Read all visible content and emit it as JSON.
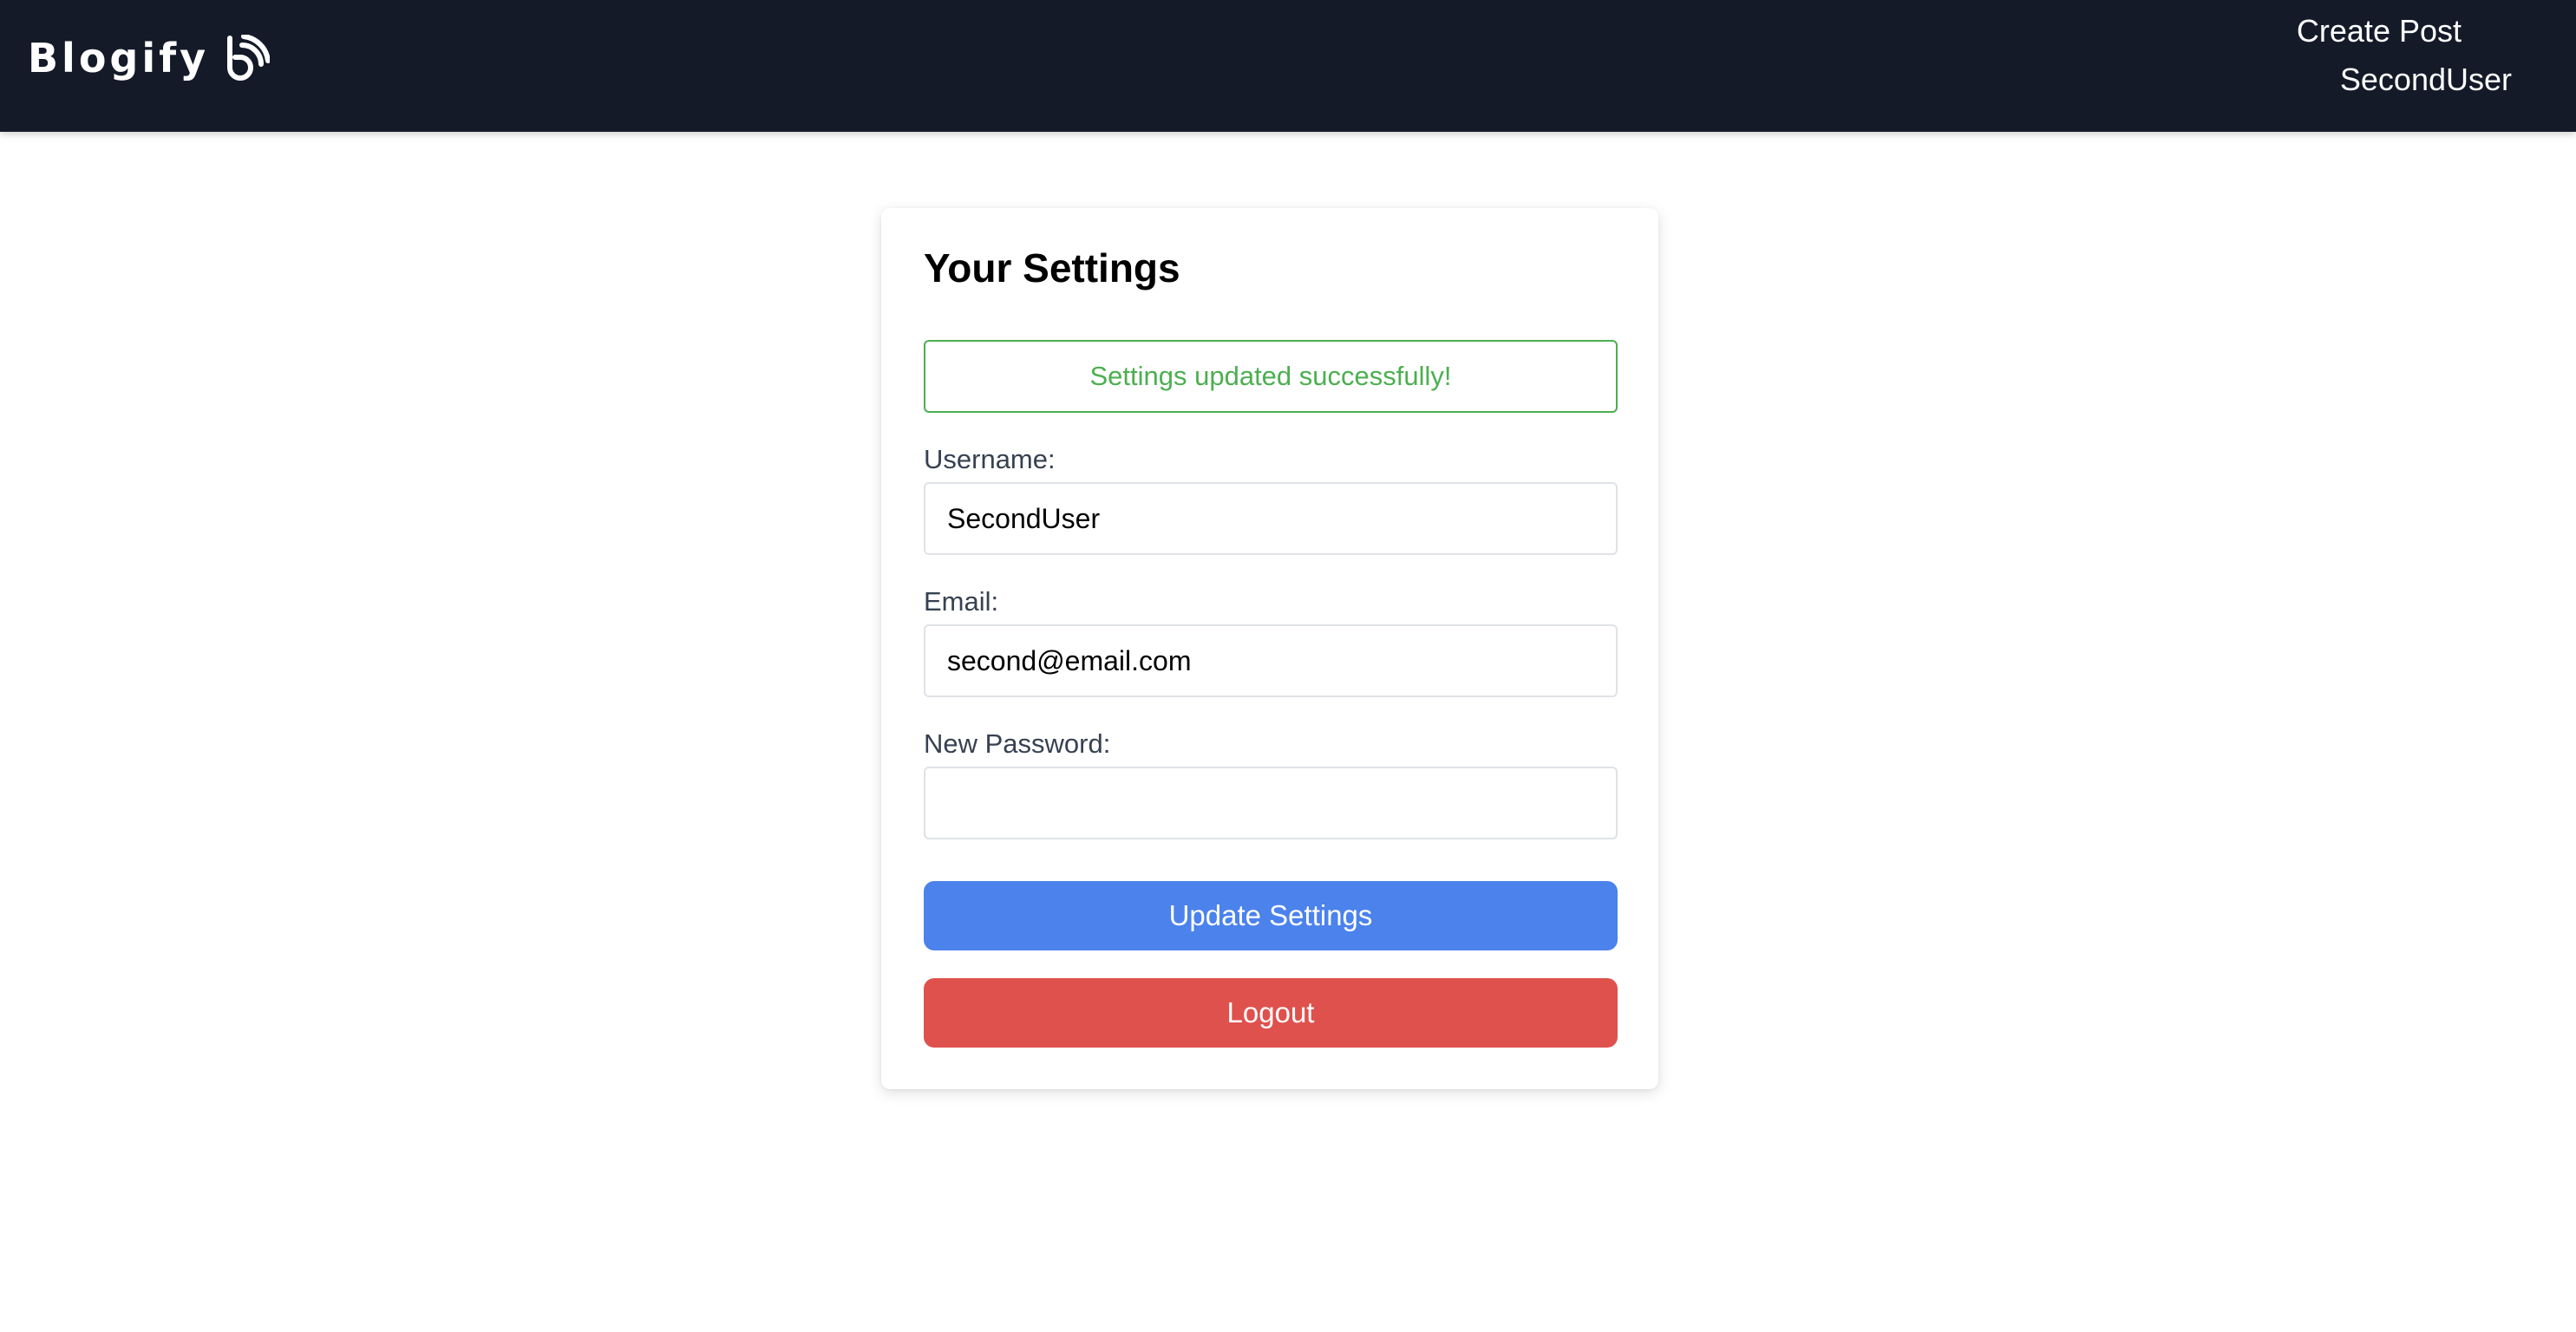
{
  "nav": {
    "brand": "Blogify",
    "brand_icon": "blog-logo-icon",
    "create_post": "Create Post",
    "username": "SecondUser"
  },
  "settings": {
    "title": "Your Settings",
    "success_message": "Settings updated successfully!",
    "username_label": "Username:",
    "username_value": "SecondUser",
    "email_label": "Email:",
    "email_value": "second@email.com",
    "password_label": "New Password:",
    "password_value": "",
    "update_button": "Update Settings",
    "logout_button": "Logout"
  },
  "colors": {
    "navbar": "#141a28",
    "success": "#4caf50",
    "primary": "#4b82ec",
    "danger": "#df514d"
  }
}
